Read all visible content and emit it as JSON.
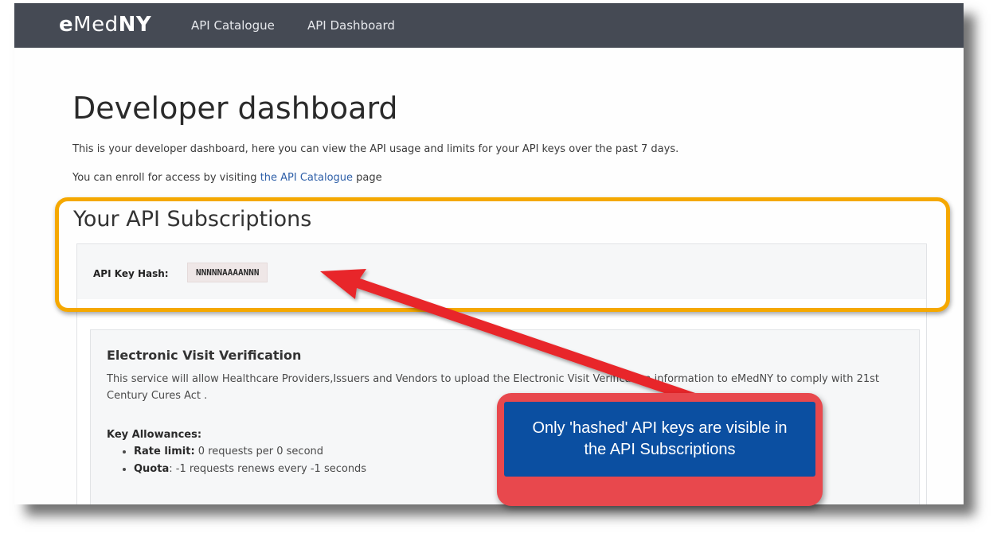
{
  "navbar": {
    "brand": {
      "part1": "e",
      "part2": "Med",
      "part3": "NY"
    },
    "links": [
      {
        "label": "API Catalogue"
      },
      {
        "label": "API Dashboard"
      }
    ]
  },
  "main": {
    "title": "Developer dashboard",
    "intro": "This is your developer dashboard, here you can view the API usage and limits for your API keys over the past 7 days.",
    "enroll": {
      "prefix": "You can enroll for access by visiting ",
      "link": "the API Catalogue",
      "suffix": " page"
    }
  },
  "subscriptions": {
    "title": "Your API Subscriptions",
    "key_hash_label": "API Key Hash:",
    "key_hash_value": "NNNNNAAAANNN"
  },
  "service": {
    "title": "Electronic Visit Verification",
    "description": "This service will allow Healthcare Providers,Issuers and Vendors to upload the Electronic Visit Verification information to eMedNY to comply with 21st Century Cures Act .",
    "allowances_heading": "Key Allowances:",
    "allowances": [
      {
        "label": "Rate limit:",
        "value": " 0 requests per 0 second"
      },
      {
        "label": "Quota",
        "value": ": -1 requests renews every -1 seconds"
      }
    ]
  },
  "annotation": {
    "callout_text": "Only 'hashed' API keys are visible in the API Subscriptions",
    "colors": {
      "highlight": "#f5a800",
      "arrow": "#e8262a",
      "callout_border": "#e8484d",
      "callout_fill": "#0b4fa1"
    }
  }
}
